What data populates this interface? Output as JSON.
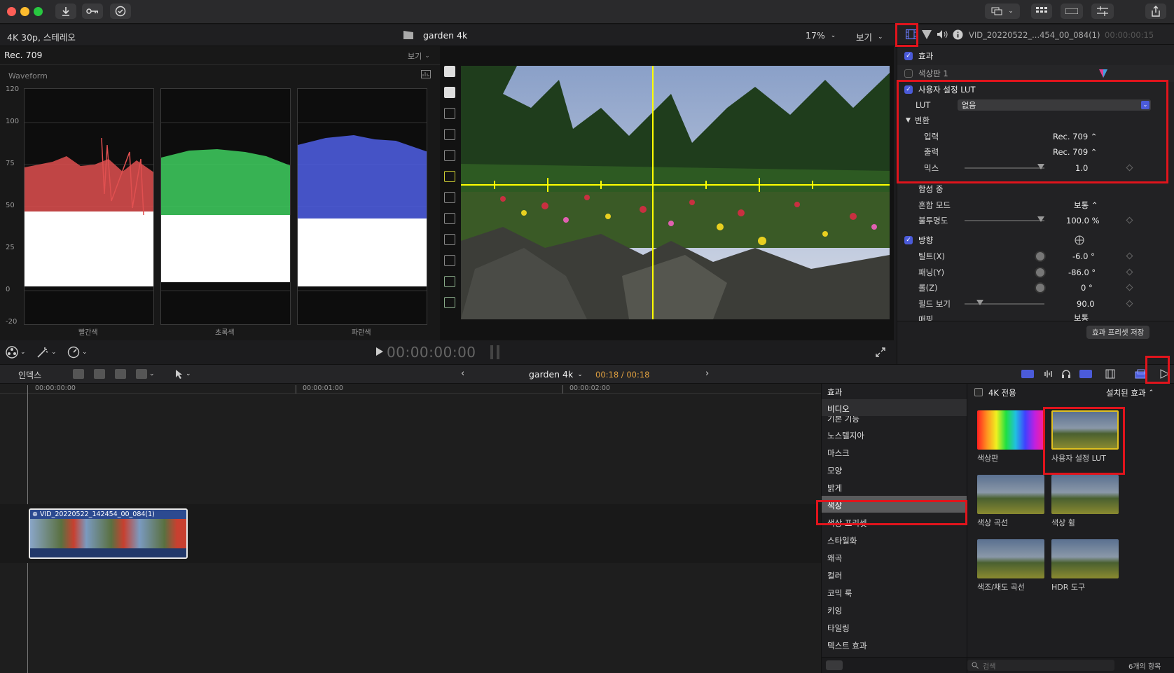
{
  "toolbar": {
    "icons": [
      "import-icon",
      "keywords-icon",
      "background-tasks-icon",
      "viewer-options-icon",
      "grid-icon",
      "timeline-icon",
      "inspector-icon",
      "share-icon"
    ]
  },
  "viewer_bar": {
    "format": "4K 30p, 스테레오",
    "project": "garden 4k",
    "zoom": "17%",
    "view": "보기"
  },
  "scopes": {
    "colorspace": "Rec. 709",
    "view": "보기",
    "type": "Waveform",
    "scale": [
      "120",
      "100",
      "75",
      "50",
      "25",
      "0",
      "-20"
    ],
    "channels": [
      "빨간색",
      "초록색",
      "파란색"
    ],
    "colors": {
      "red": "#e05050",
      "green": "#40d060",
      "blue": "#5060e8"
    }
  },
  "playback": {
    "timecode": "00:00:00:00"
  },
  "inspector": {
    "clip_name": "VID_20220522_...454_00_084(1)",
    "timecode": "00:00:00:15",
    "effects_label": "효과",
    "color_board": "색상판 1",
    "custom_lut": "사용자 설정 LUT",
    "lut_label": "LUT",
    "lut_value": "없음",
    "transform_label": "변환",
    "input_label": "입력",
    "input_value": "Rec. 709",
    "output_label": "출력",
    "output_value": "Rec. 709",
    "mix_label": "믹스",
    "mix_value": "1.0",
    "compositing": "합성 중",
    "blend_label": "혼합 모드",
    "blend_value": "보통",
    "opacity_label": "불투명도",
    "opacity_value": "100.0 %",
    "orientation": "방향",
    "tilt_label": "틸트(X)",
    "tilt_value": "-6.0 °",
    "pan_label": "패닝(Y)",
    "pan_value": "-86.0 °",
    "roll_label": "롤(Z)",
    "roll_value": "0 °",
    "fov_label": "필드 보기",
    "fov_value": "90.0",
    "mapping_label": "매핑",
    "mapping_value": "보통",
    "save_preset": "효과 프리셋 저장"
  },
  "timeline_bar": {
    "index": "인덱스",
    "project": "garden 4k",
    "position": "00:18 / 00:18"
  },
  "timeline": {
    "ruler": [
      "00:00:00:00",
      "00:00:01:00",
      "00:00:02:00"
    ],
    "clip": "VID_20220522_142454_00_084(1)"
  },
  "effects_browser": {
    "header": "효과",
    "categories": [
      "비디오",
      "기본 기능",
      "노스텔지아",
      "마스크",
      "모양",
      "밝게",
      "색상",
      "색상 프리셋",
      "스타일화",
      "왜곡",
      "컬러",
      "코믹 룩",
      "키잉",
      "타일링",
      "텍스트 효과"
    ],
    "filter_label": "4K 전용",
    "installed": "설치된 효과",
    "items": [
      "색상판",
      "사용자 설정 LUT",
      "색상 곡선",
      "색상 휠",
      "색조/채도 곡선",
      "HDR 도구"
    ],
    "search_placeholder": "검색",
    "count": "6개의 항목"
  }
}
